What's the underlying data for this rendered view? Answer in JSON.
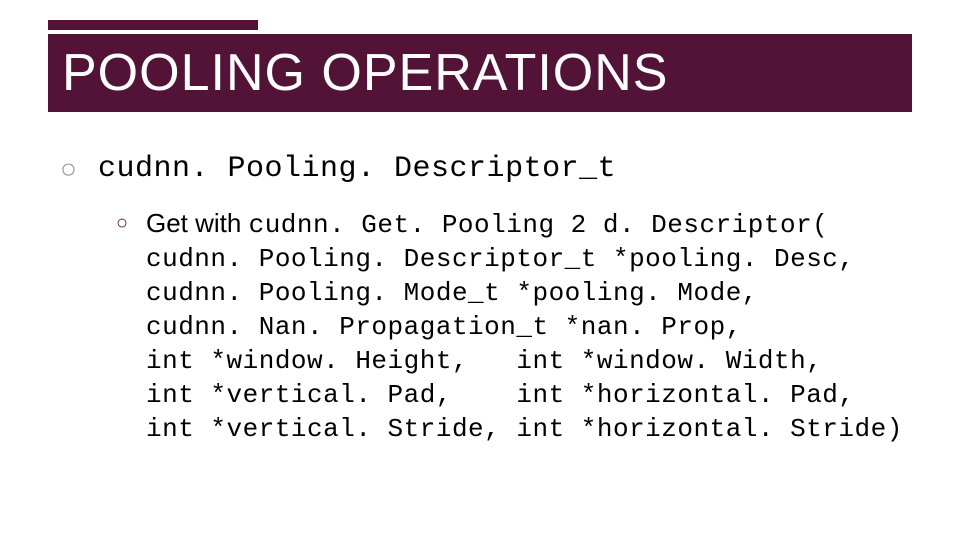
{
  "title": "POOLING OPERATIONS",
  "bullets": {
    "lvl1": "cudnn. Pooling. Descriptor_t",
    "lvl2_prefix": "Get with ",
    "lvl2_func": "cudnn. Get. Pooling 2 d. Descriptor(",
    "code_lines": [
      "cudnn. Pooling. Descriptor_t *pooling. Desc,",
      "cudnn. Pooling. Mode_t *pooling. Mode,",
      "cudnn. Nan. Propagation_t *nan. Prop,",
      "int *window. Height,   int *window. Width,",
      "int *vertical. Pad,    int *horizontal. Pad,",
      "int *vertical. Stride, int *horizontal. Stride)"
    ]
  }
}
